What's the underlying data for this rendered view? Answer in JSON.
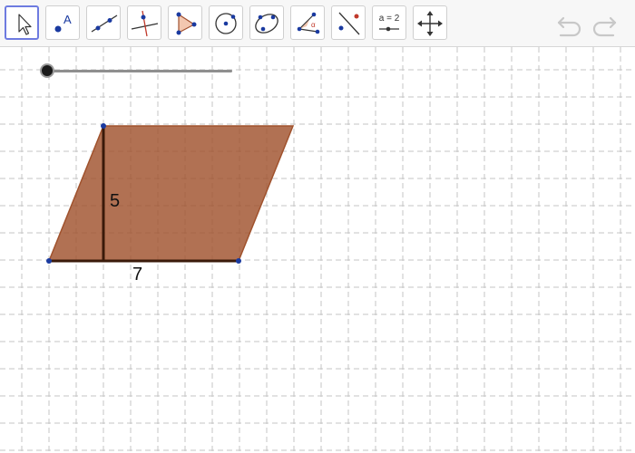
{
  "toolbar": {
    "tools": [
      {
        "name": "move-tool",
        "selected": true
      },
      {
        "name": "point-tool"
      },
      {
        "name": "line-tool"
      },
      {
        "name": "perpendicular-line-tool"
      },
      {
        "name": "polygon-tool"
      },
      {
        "name": "circle-tool"
      },
      {
        "name": "conic-tool"
      },
      {
        "name": "angle-tool"
      },
      {
        "name": "reflect-tool"
      },
      {
        "name": "slider-tool",
        "icon_label": "a = 2"
      },
      {
        "name": "move-graphics-view-tool"
      }
    ],
    "undo_icon": "undo-icon",
    "redo_icon": "redo-icon"
  },
  "slider": {
    "value_fraction": 0
  },
  "figure": {
    "height_label": "5",
    "base_label": "7",
    "fill_color": "#a0522d",
    "stroke_color": "#3a1a0a",
    "point_color": "#1a3aa0"
  }
}
